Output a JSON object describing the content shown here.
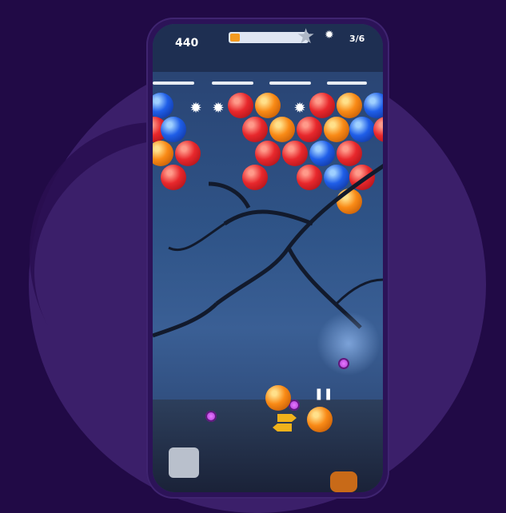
{
  "hud": {
    "score": "440",
    "level_progress": 0.12,
    "bubbles_count": "3/6"
  },
  "icons": {
    "star": "star-icon",
    "gear": "gear-icon",
    "pause": "pause-icon"
  },
  "colors": {
    "red": "#e8282c",
    "orange": "#f98a16",
    "blue": "#1f5ee8",
    "background": "#210a46"
  },
  "board": {
    "rows": [
      [
        "blue",
        "spark",
        "spark",
        "red",
        "orange",
        "spark",
        "red",
        "orange",
        "blue"
      ],
      [
        "red",
        "blue",
        "red",
        "orange",
        "red",
        "orange",
        "blue",
        "red"
      ],
      [
        "orange",
        "red",
        "red",
        "red",
        "blue",
        "red"
      ],
      [
        "red",
        "red",
        "red",
        "blue",
        "red"
      ],
      [
        "orange"
      ]
    ]
  },
  "shooter": {
    "current_color": "orange",
    "next_color": "orange"
  }
}
